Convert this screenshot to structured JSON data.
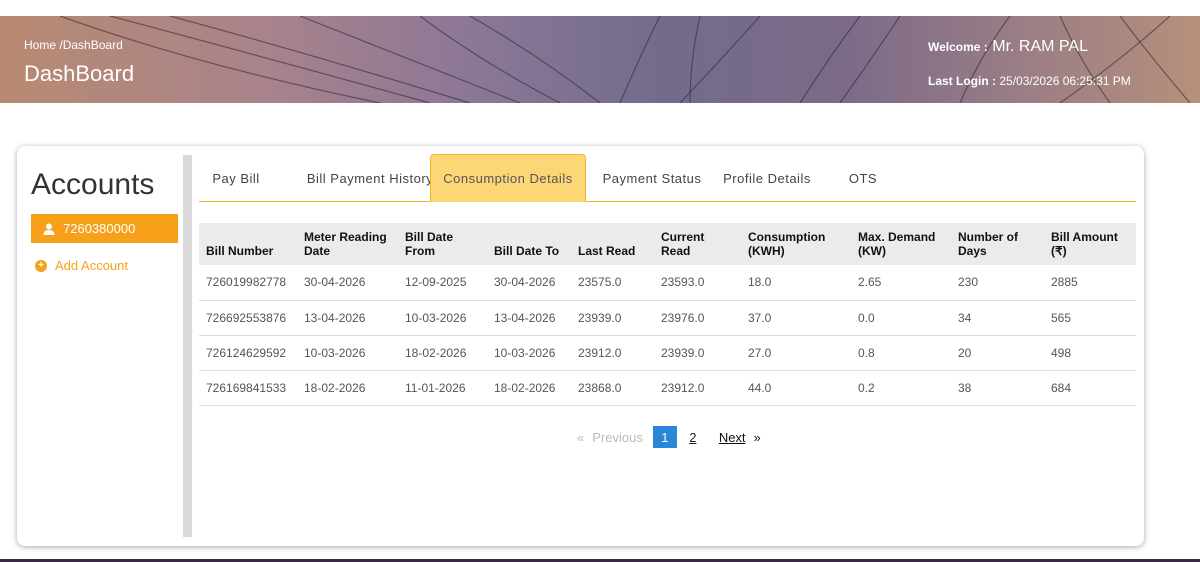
{
  "header": {
    "breadcrumb_home": "Home",
    "breadcrumb_sep": "/",
    "breadcrumb_current": "DashBoard",
    "page_title": "DashBoard",
    "welcome_label": "Welcome :",
    "welcome_name": "Mr. RAM PAL",
    "last_login_label": "Last Login :",
    "last_login_value": "25/03/2026 06:25:31 PM"
  },
  "sidebar": {
    "title": "Accounts",
    "account_number": "7260380000",
    "add_account_label": "Add Account",
    "user_icon": "user-icon",
    "add_icon": "plus-circle-icon"
  },
  "tabs": [
    {
      "label": "Pay Bill"
    },
    {
      "label": "Bill Payment History"
    },
    {
      "label": "Consumption Details",
      "active": true
    },
    {
      "label": "Payment Status"
    },
    {
      "label": "Profile Details"
    },
    {
      "label": "OTS"
    }
  ],
  "table": {
    "headers": [
      "Bill Number",
      "Meter Reading Date",
      "Bill Date From",
      "Bill Date To",
      "Last Read",
      "Current Read",
      "Consumption (KWH)",
      "Max. Demand (KW)",
      "Number of Days",
      "Bill Amount (₹)"
    ],
    "rows": [
      [
        "726019982778",
        "30-04-2026",
        "12-09-2025",
        "30-04-2026",
        "23575.0",
        "23593.0",
        "18.0",
        "2.65",
        "230",
        "2885"
      ],
      [
        "726692553876",
        "13-04-2026",
        "10-03-2026",
        "13-04-2026",
        "23939.0",
        "23976.0",
        "37.0",
        "0.0",
        "34",
        "565"
      ],
      [
        "726124629592",
        "10-03-2026",
        "18-02-2026",
        "10-03-2026",
        "23912.0",
        "23939.0",
        "27.0",
        "0.8",
        "20",
        "498"
      ],
      [
        "726169841533",
        "18-02-2026",
        "11-01-2026",
        "18-02-2026",
        "23868.0",
        "23912.0",
        "44.0",
        "0.2",
        "38",
        "684"
      ]
    ]
  },
  "pagination": {
    "prev_symbol": "«",
    "prev_label": "Previous",
    "pages": [
      "1",
      "2"
    ],
    "current_page": "1",
    "next_label": "Next",
    "next_symbol": "»"
  },
  "colors": {
    "accent": "#f7a11a",
    "active_tab": "#fdd775",
    "current_page": "#2a86d8"
  }
}
